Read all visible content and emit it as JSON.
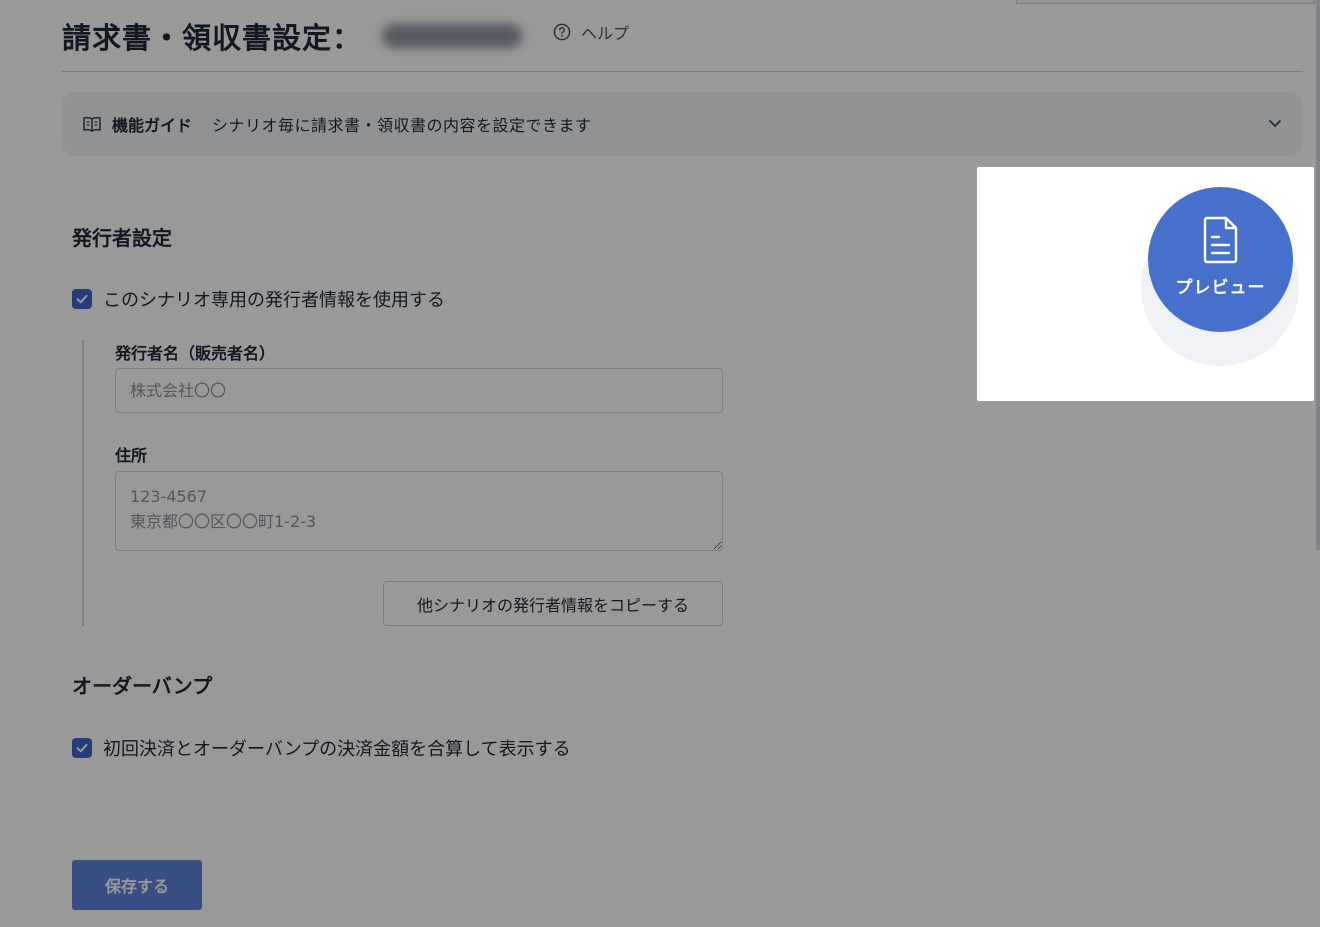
{
  "header": {
    "title": "請求書・領収書設定：",
    "help_label": "ヘルプ"
  },
  "guide": {
    "label": "機能ガイド",
    "text": "シナリオ毎に請求書・領収書の内容を設定できます"
  },
  "issuer_section": {
    "heading": "発行者設定",
    "use_dedicated_label": "このシナリオ専用の発行者情報を使用する",
    "use_dedicated_checked": true,
    "name_label": "発行者名（販売者名）",
    "name_placeholder": "株式会社〇〇",
    "name_value": "",
    "address_label": "住所",
    "address_placeholder": "123-4567\n東京都〇〇区〇〇町1-2-3",
    "address_value": "",
    "copy_button_label": "他シナリオの発行者情報をコピーする"
  },
  "order_bump_section": {
    "heading": "オーダーバンプ",
    "combine_label": "初回決済とオーダーバンプの決済金額を合算して表示する",
    "combine_checked": true
  },
  "footer": {
    "save_label": "保存する"
  },
  "preview": {
    "label": "プレビュー"
  },
  "colors": {
    "accent": "#4670cc",
    "checkbox": "#3f67c8",
    "overlay": "rgba(0,0,0,0.40)"
  },
  "icons": {
    "help": "question-circle-icon",
    "guide": "open-book-icon",
    "expand": "chevron-down-icon",
    "preview": "document-icon",
    "check": "check-icon"
  }
}
